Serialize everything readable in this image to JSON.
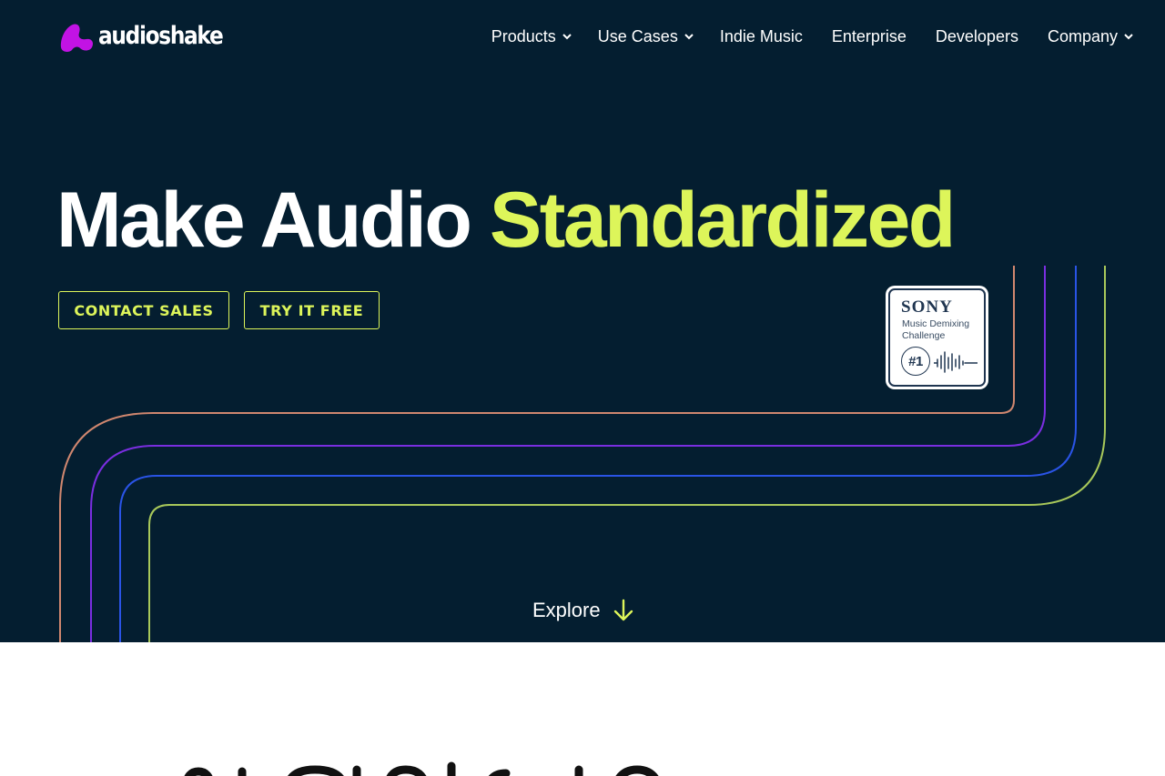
{
  "brand": {
    "name": "audioshake",
    "logo_color": "#c213e4"
  },
  "nav": {
    "items": [
      {
        "label": "Products",
        "dropdown": true
      },
      {
        "label": "Use Cases",
        "dropdown": true
      },
      {
        "label": "Indie Music",
        "dropdown": false
      },
      {
        "label": "Enterprise",
        "dropdown": false
      },
      {
        "label": "Developers",
        "dropdown": false
      },
      {
        "label": "Company",
        "dropdown": true
      }
    ]
  },
  "hero": {
    "headline_static": "Make Audio",
    "headline_highlight": "Standardized",
    "buttons": {
      "contact": "CONTACT SALES",
      "try": "TRY IT FREE"
    },
    "badge": {
      "brand": "SONY",
      "line1": "Music Demixing",
      "line2": "Challenge",
      "rank": "#1"
    },
    "explore": "Explore"
  },
  "colors": {
    "hero_bg": "#041e30",
    "accent": "#ddf55a",
    "line_orange": "#d0876f",
    "line_purple": "#7a2ee0",
    "line_blue": "#2a54e6",
    "line_green": "#a8c85a"
  },
  "icons": [
    "chevron-down-icon",
    "arrow-down-icon",
    "waveform-icon"
  ]
}
